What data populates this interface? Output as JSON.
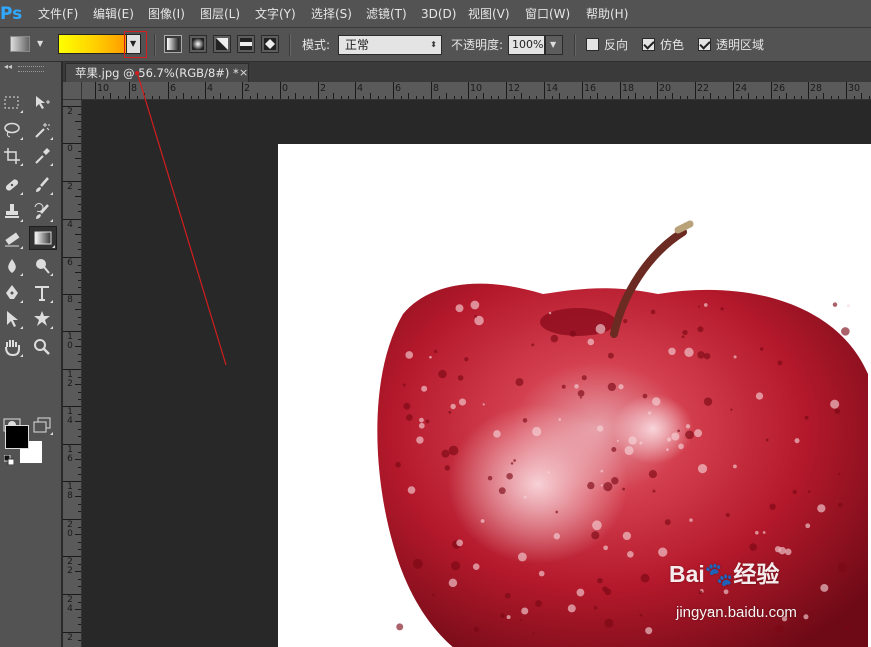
{
  "app": {
    "logo": "Ps"
  },
  "menu": [
    "文件(F)",
    "编辑(E)",
    "图像(I)",
    "图层(L)",
    "文字(Y)",
    "选择(S)",
    "滤镜(T)",
    "3D(D)",
    "视图(V)",
    "窗口(W)",
    "帮助(H)"
  ],
  "options": {
    "gradient_colors": [
      "#ffff00",
      "#ffd400",
      "#ff9c00"
    ],
    "gradient_types": [
      "linear-gradient-icon",
      "radial-gradient-icon",
      "angle-gradient-icon",
      "reflected-gradient-icon",
      "diamond-gradient-icon"
    ],
    "mode_label": "模式:",
    "mode_value": "正常",
    "opacity_label": "不透明度:",
    "opacity_value": "100%",
    "reverse_label": "反向",
    "reverse_checked": false,
    "dither_label": "仿色",
    "dither_checked": true,
    "transparency_label": "透明区域",
    "transparency_checked": true
  },
  "tools": [
    "marquee-tool-icon",
    "move-tool-icon",
    "lasso-tool-icon",
    "magic-wand-tool-icon",
    "crop-tool-icon",
    "eyedropper-tool-icon",
    "healing-brush-tool-icon",
    "brush-tool-icon",
    "clone-stamp-tool-icon",
    "history-brush-tool-icon",
    "eraser-tool-icon",
    "gradient-tool-icon",
    "blur-tool-icon",
    "dodge-tool-icon",
    "pen-tool-icon",
    "type-tool-icon",
    "path-selection-tool-icon",
    "custom-shape-tool-icon",
    "hand-tool-icon",
    "zoom-tool-icon",
    "quick-mask-icon",
    "screen-mode-icon"
  ],
  "colors": {
    "foreground": "#000000",
    "background": "#ffffff"
  },
  "document": {
    "tab_title": "苹果.jpg @ 56.7%(RGB/8#) *",
    "close": "×"
  },
  "rulers": {
    "horizontal": [
      "10",
      "8",
      "6",
      "4",
      "2",
      "0",
      "2",
      "4",
      "6",
      "8",
      "10",
      "12",
      "14",
      "16",
      "18",
      "20",
      "22",
      "24",
      "26",
      "28",
      "30"
    ],
    "vertical": [
      "2",
      "0",
      "2",
      "4",
      "6",
      "8",
      "10",
      "12",
      "14",
      "16",
      "18",
      "20",
      "22",
      "24",
      "2"
    ]
  },
  "watermark": {
    "logo": "Bai🐾经验",
    "url": "jingyan.baidu.com"
  }
}
